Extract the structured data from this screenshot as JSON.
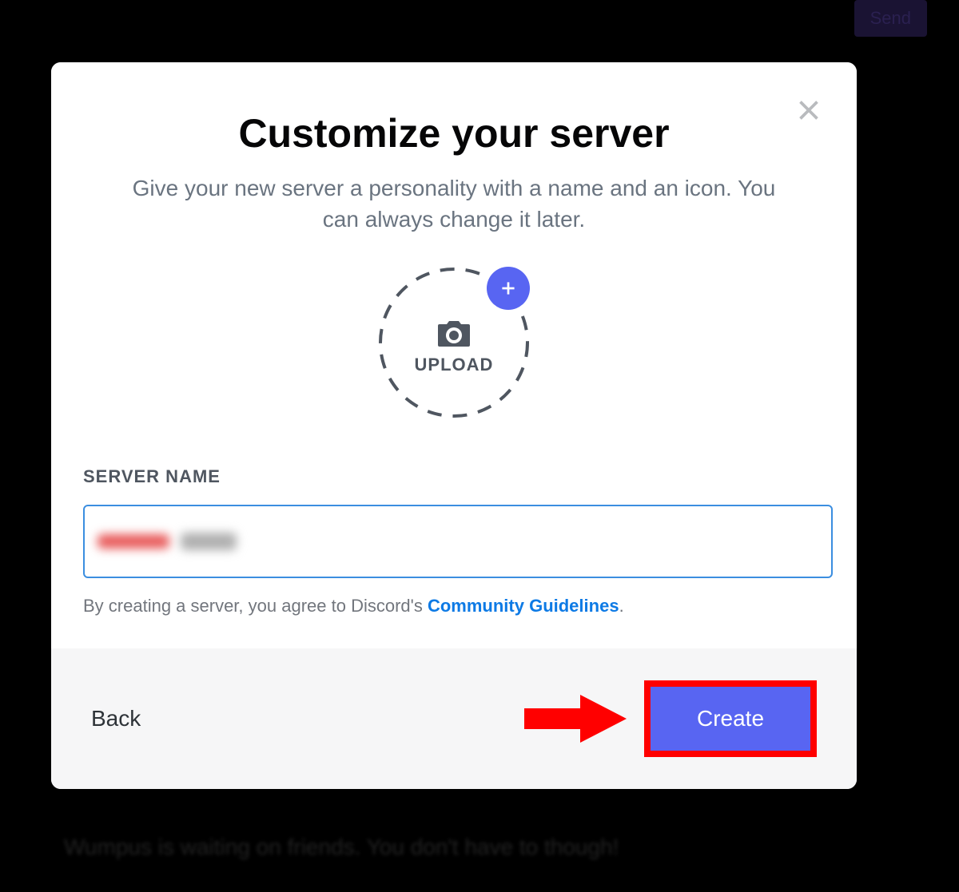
{
  "background": {
    "send_button": "Send",
    "wumpus_text": "Wumpus is waiting on friends. You don't have to though!"
  },
  "modal": {
    "title": "Customize your server",
    "subtitle": "Give your new server a personality with a name and an icon. You can always change it later.",
    "upload": {
      "label": "UPLOAD"
    },
    "form": {
      "server_name_label": "SERVER NAME",
      "server_name_value": ""
    },
    "terms": {
      "prefix": "By creating a server, you agree to Discord's ",
      "link_text": "Community Guidelines",
      "suffix": "."
    },
    "footer": {
      "back_label": "Back",
      "create_label": "Create"
    }
  },
  "annotation": {
    "arrow_color": "#ff0000",
    "highlight_color": "#ff0000"
  }
}
